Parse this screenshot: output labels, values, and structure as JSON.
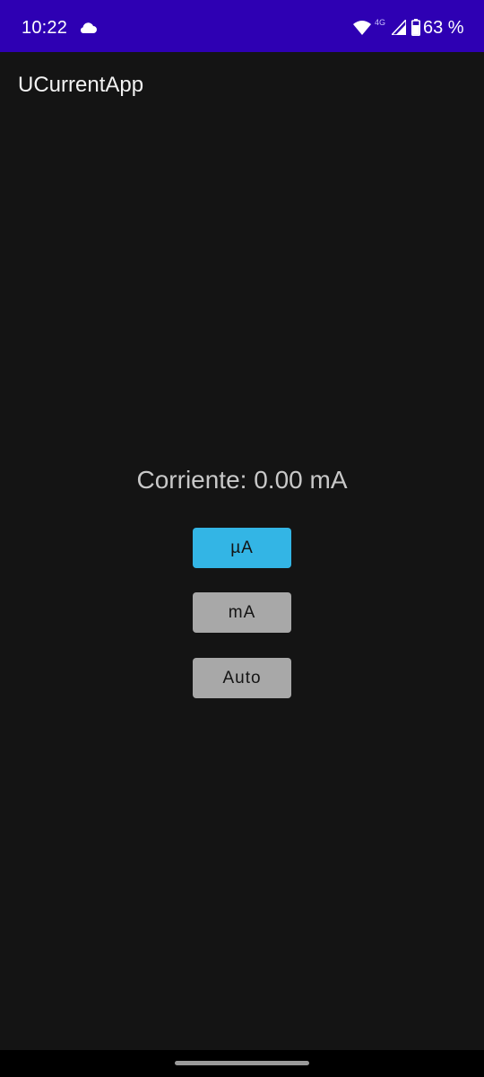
{
  "status_bar": {
    "time": "10:22",
    "network_type": "4G",
    "battery": "63 %",
    "icons": [
      "cloud-icon",
      "wifi-icon",
      "signal-icon",
      "battery-icon"
    ]
  },
  "app": {
    "title": "UCurrentApp"
  },
  "reading": {
    "text": "Corriente: 0.00 mA"
  },
  "buttons": {
    "micro_label": "µA",
    "milli_label": "mA",
    "auto_label": "Auto"
  },
  "colors": {
    "status_bar_bg": "#2e00b3",
    "background": "#141414",
    "active_button": "#33b5e5",
    "inactive_button": "#a8a8a8"
  }
}
